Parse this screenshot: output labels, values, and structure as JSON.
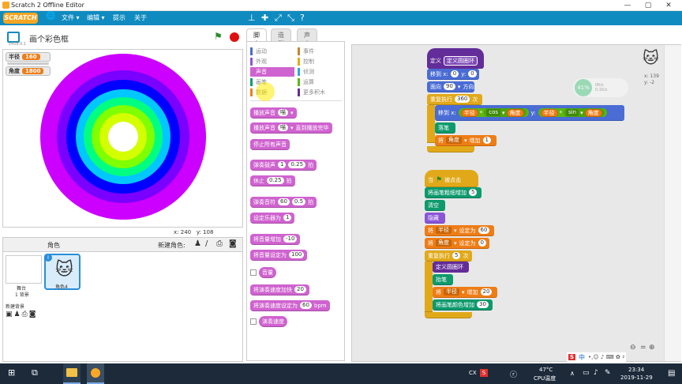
{
  "window": {
    "title": "Scratch 2 Offline Editor",
    "controls": [
      "—",
      "▢",
      "✕"
    ]
  },
  "menubar": {
    "logo": "SCRATCH",
    "file": "文件",
    "edit": "编辑",
    "tips": "提示",
    "about": "关于",
    "tools": [
      "stamp-icon",
      "cut-icon",
      "grow-icon",
      "shrink-icon",
      "help-icon"
    ]
  },
  "stage": {
    "title": "画个彩色框",
    "version": "v458.0.1",
    "variables": [
      {
        "name": "半径",
        "value": "160"
      },
      {
        "name": "角度",
        "value": "1800"
      }
    ],
    "rings": [
      "#cc00ff",
      "#7a00ff",
      "#0000ff",
      "#00c8ff",
      "#00ff80",
      "#80ff00",
      "#d4ff00"
    ],
    "coord_x_label": "x:",
    "coord_x": "240",
    "coord_y_label": "y:",
    "coord_y": "108"
  },
  "sprites": {
    "header": "角色",
    "new_sprite": "新建角色:",
    "stage_label": "舞台",
    "stage_sub": "1 背景",
    "new_backdrop": "新建背景",
    "sprite_name": "角色4"
  },
  "tabs": [
    "脚本",
    "造型",
    "声音"
  ],
  "categories": [
    {
      "label": "运动",
      "color": "#4a6cd4"
    },
    {
      "label": "事件",
      "color": "#c88330"
    },
    {
      "label": "外观",
      "color": "#8a55d7"
    },
    {
      "label": "控制",
      "color": "#e1a91a"
    },
    {
      "label": "声音",
      "color": "#cf63cf"
    },
    {
      "label": "侦测",
      "color": "#2ca5e2"
    },
    {
      "label": "画笔",
      "color": "#0e9a6c"
    },
    {
      "label": "运算",
      "color": "#5cb712"
    },
    {
      "label": "数据",
      "color": "#ee7d16"
    },
    {
      "label": "更多积木",
      "color": "#632d99"
    }
  ],
  "palette": {
    "b1": "播放声音",
    "b1_dd": "喵",
    "b2": "播放声音",
    "b2_dd": "喵",
    "b2b": "直到播放完毕",
    "b3": "停止所有声音",
    "b4": "弹奏鼓声",
    "b4_n1": "1",
    "b4_n2": "0.25",
    "b4b": "拍",
    "b5": "休止",
    "b5_n": "0.25",
    "b5b": "拍",
    "b6": "弹奏音符",
    "b6_n1": "60",
    "b6_n2": "0.5",
    "b6b": "拍",
    "b7": "设定乐器为",
    "b7_n": "1",
    "b8": "将音量增加",
    "b8_n": "-10",
    "b9": "将音量设定为",
    "b9_n": "100",
    "b10": "音量",
    "b11": "将演奏速度加快",
    "b11_n": "20",
    "b12": "将演奏速度设定为",
    "b12_n": "60",
    "b12b": "bpm",
    "b13": "演奏速度"
  },
  "script1": {
    "define": "定义",
    "define_name": "定义圆圈环",
    "goto": "移到 x:",
    "goto_x": "0",
    "goto_y_label": "y:",
    "goto_y": "0",
    "point": "面向",
    "point_n": "90",
    "point_b": "方向",
    "repeat": "重复执行",
    "repeat_n": "360",
    "repeat_b": "次",
    "move": "移到 x:",
    "v_r": "半径",
    "op_mul": "*",
    "fn_cos": "cos",
    "v_a": "角度",
    "move_y": "y:",
    "fn_sin": "sin",
    "pen_down": "落笔",
    "change": "将",
    "change_var": "角度",
    "change_b": "增加",
    "change_n": "1"
  },
  "script2": {
    "when": "当",
    "when_b": "被点击",
    "pen_size": "将画笔粗细增加",
    "pen_size_n": "5",
    "clear": "清空",
    "hide": "隐藏",
    "set1": "将",
    "set1_var": "半径",
    "set1_b": "设定为",
    "set1_n": "60",
    "set2": "将",
    "set2_var": "角度",
    "set2_b": "设定为",
    "set2_n": "0",
    "repeat": "重复执行",
    "repeat_n": "5",
    "repeat_b": "次",
    "call": "定义圆圈环",
    "pen_up": "抬笔",
    "change": "将",
    "change_var": "半径",
    "change_b": "增加",
    "change_n": "20",
    "color": "将画笔颜色增加",
    "color_n": "30"
  },
  "sprite_info": {
    "x": "x: 139",
    "y": "y: -2"
  },
  "net_widget": {
    "percent": "41%",
    "up": "0K/s",
    "down": "0.1K/s"
  },
  "zoom": [
    "zoom-out-icon",
    "=",
    "zoom-in-icon"
  ],
  "taskbar": {
    "temp": "47°C",
    "temp_label": "CPU温度",
    "ime": "中",
    "time": "23:34",
    "date": "2019-11-29"
  }
}
